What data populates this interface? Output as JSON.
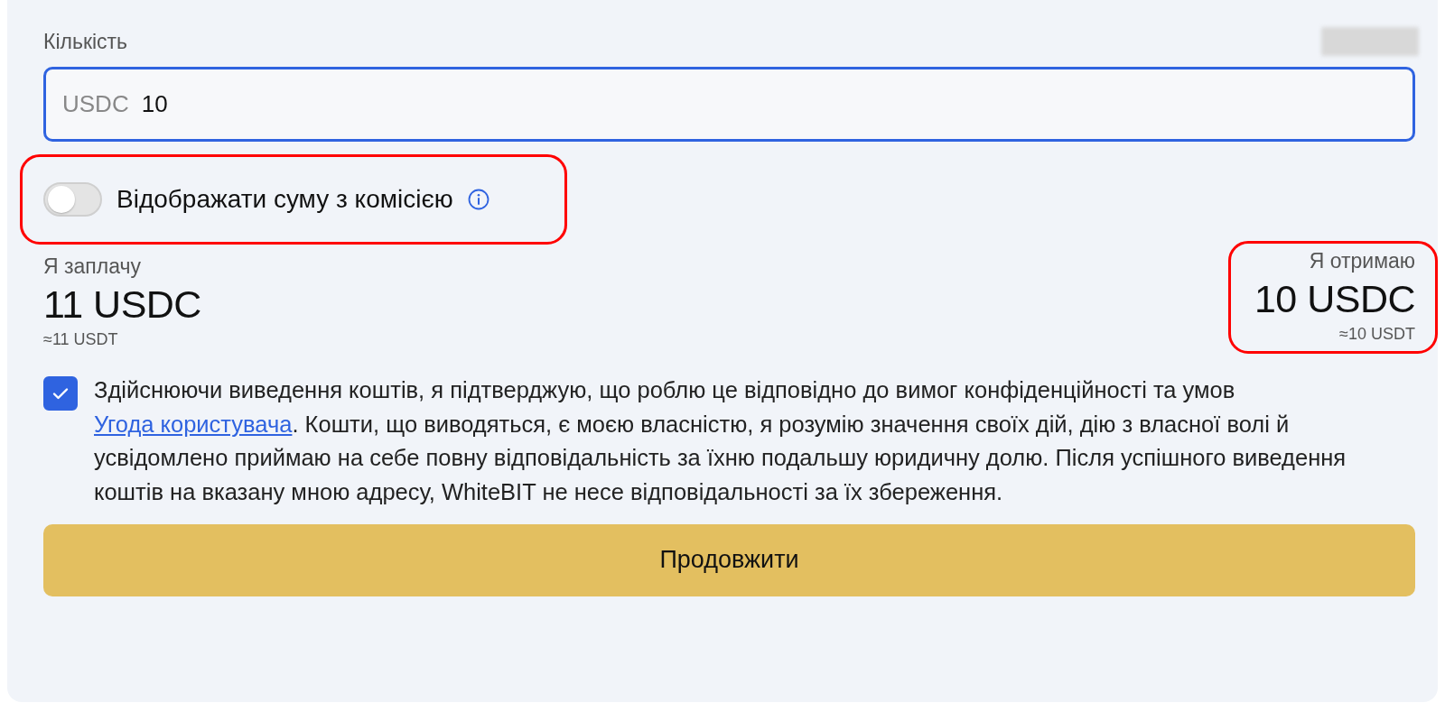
{
  "amount_field": {
    "label": "Кількість",
    "prefix": "USDC",
    "value": "10"
  },
  "fee_toggle": {
    "label": "Відображати суму з комісією",
    "on": false,
    "highlighted": true
  },
  "pay": {
    "label": "Я заплачу",
    "amount": "11 USDC",
    "approx": "≈11 USDT"
  },
  "receive": {
    "label": "Я отримаю",
    "amount": "10 USDC",
    "approx": "≈10 USDT",
    "highlighted": true
  },
  "agreement": {
    "checked": true,
    "text_before": "Здійснюючи виведення коштів, я підтверджую, що роблю це відповідно до вимог конфіденційності та умов ",
    "link": "Угода користувача",
    "text_after": ". Кошти, що виводяться, є моєю власністю, я розумію значення своїх дій, дію з власної волі й усвідомлено приймаю на себе повну відповідальність за їхню подальшу юридичну долю. Після успішного виведення коштів на вказану мною адресу, WhiteBIT не несе відповідальності за їх збереження."
  },
  "continue_button": "Продовжити"
}
